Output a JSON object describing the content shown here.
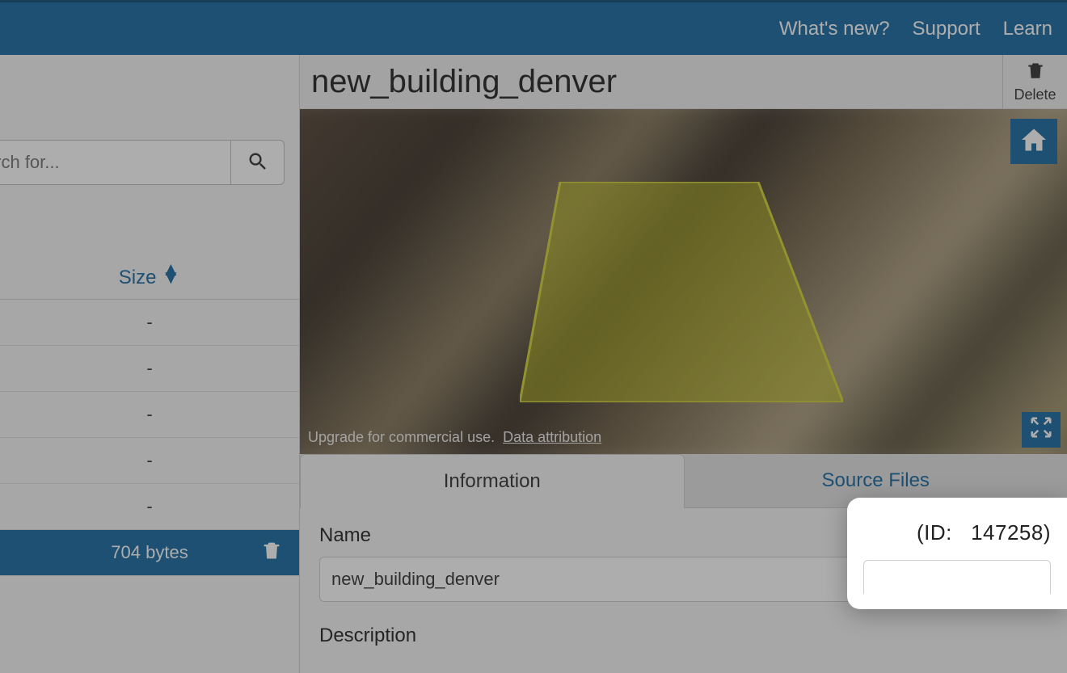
{
  "topbar": {
    "whats_new": "What's new?",
    "support": "Support",
    "learn": "Learn"
  },
  "search": {
    "placeholder": "Search for..."
  },
  "list": {
    "size_header": "Size",
    "rows": [
      {
        "size": "-"
      },
      {
        "size": "-"
      },
      {
        "size": "-"
      },
      {
        "size": "-"
      },
      {
        "size": "-"
      },
      {
        "size": "704 bytes",
        "selected": true
      }
    ]
  },
  "asset": {
    "title": "new_building_denver",
    "delete_label": "Delete",
    "id_label": "(ID:",
    "id_value": "147258)",
    "attribution_prefix": "Upgrade for commercial use.",
    "attribution_link": "Data attribution"
  },
  "tabs": {
    "information": "Information",
    "source_files": "Source Files"
  },
  "form": {
    "name_label": "Name",
    "name_value": "new_building_denver",
    "description_label": "Description"
  }
}
